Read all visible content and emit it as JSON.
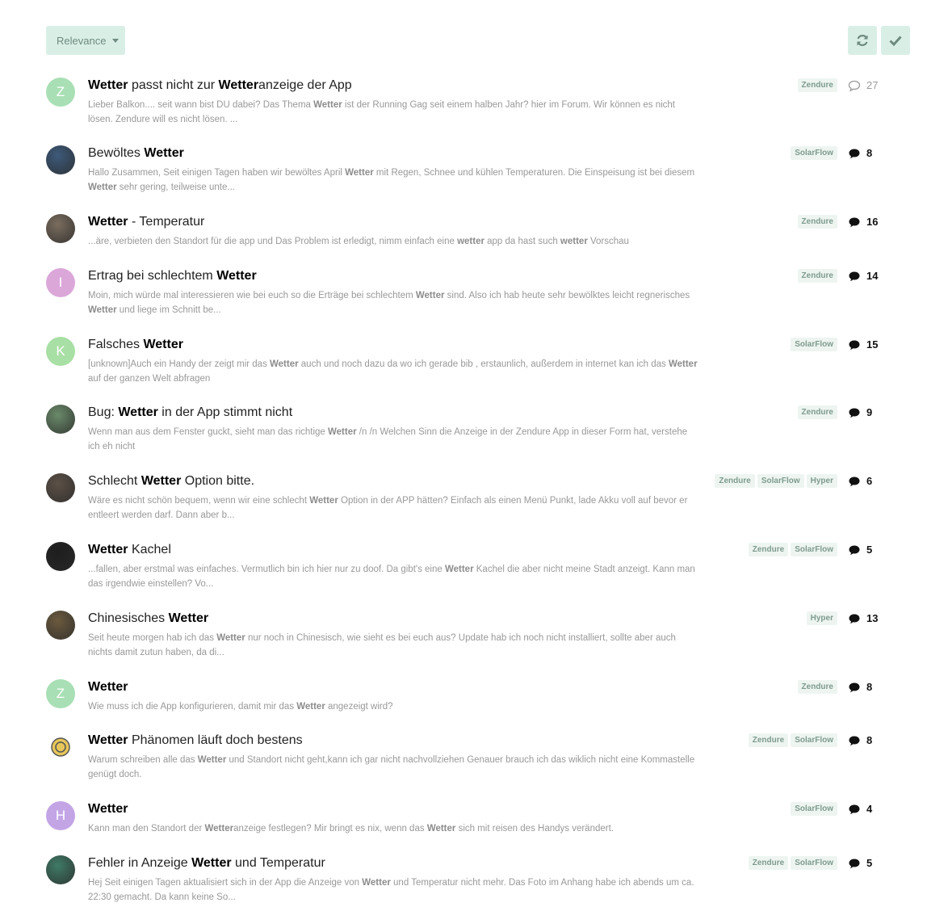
{
  "toolbar": {
    "sort_label": "Relevance"
  },
  "topics": [
    {
      "avatar_letter": "Z",
      "avatar_color": "#a8dfb4",
      "title": [
        {
          "b": true,
          "t": "Wetter"
        },
        {
          "b": false,
          "t": " passt nicht zur "
        },
        {
          "b": true,
          "t": "Wetter"
        },
        {
          "b": false,
          "t": "anzeige der App"
        }
      ],
      "snippet": [
        {
          "b": false,
          "t": "Lieber Balkon.... seit wann bist DU dabei? Das Thema "
        },
        {
          "b": true,
          "t": "Wetter"
        },
        {
          "b": false,
          "t": " ist der Running Gag seit einem halben Jahr? hier im Forum. Wir können es nicht lösen. Zendure will es nicht lösen. ..."
        }
      ],
      "tags": [
        "Zendure"
      ],
      "count": "27",
      "count_style": "outline"
    },
    {
      "avatar_letter": "",
      "avatar_color": "#3d5a7a",
      "title": [
        {
          "b": false,
          "t": "Bewöltes "
        },
        {
          "b": true,
          "t": "Wetter"
        }
      ],
      "snippet": [
        {
          "b": false,
          "t": "Hallo Zusammen, Seit einigen Tagen haben wir bewöltes April "
        },
        {
          "b": true,
          "t": "Wetter"
        },
        {
          "b": false,
          "t": " mit Regen, Schnee und kühlen Temperaturen. Die Einspeisung ist bei diesem "
        },
        {
          "b": true,
          "t": "Wetter"
        },
        {
          "b": false,
          "t": " sehr gering, teilweise unte..."
        }
      ],
      "tags": [
        "SolarFlow"
      ],
      "count": "8",
      "count_style": "solid"
    },
    {
      "avatar_letter": "",
      "avatar_color": "#7a6d5e",
      "title": [
        {
          "b": true,
          "t": "Wetter"
        },
        {
          "b": false,
          "t": " - Temperatur"
        }
      ],
      "snippet": [
        {
          "b": false,
          "t": "...äre, verbieten den Standort für die app und Das Problem ist erledigt, nimm einfach eine "
        },
        {
          "b": true,
          "t": "wetter"
        },
        {
          "b": false,
          "t": " app da hast such "
        },
        {
          "b": true,
          "t": "wetter"
        },
        {
          "b": false,
          "t": " Vorschau"
        }
      ],
      "tags": [
        "Zendure"
      ],
      "count": "16",
      "count_style": "solid"
    },
    {
      "avatar_letter": "I",
      "avatar_color": "#dba7d9",
      "title": [
        {
          "b": false,
          "t": "Ertrag bei schlechtem "
        },
        {
          "b": true,
          "t": "Wetter"
        }
      ],
      "snippet": [
        {
          "b": false,
          "t": "Moin, mich würde mal interessieren wie bei euch so die Erträge bei schlechtem "
        },
        {
          "b": true,
          "t": "Wetter"
        },
        {
          "b": false,
          "t": " sind. Also ich hab heute sehr bewölktes leicht regnerisches "
        },
        {
          "b": true,
          "t": "Wetter"
        },
        {
          "b": false,
          "t": " und liege im Schnitt be..."
        }
      ],
      "tags": [
        "Zendure"
      ],
      "count": "14",
      "count_style": "solid"
    },
    {
      "avatar_letter": "K",
      "avatar_color": "#a8dfa4",
      "title": [
        {
          "b": false,
          "t": "Falsches "
        },
        {
          "b": true,
          "t": "Wetter"
        }
      ],
      "snippet": [
        {
          "b": false,
          "t": "[unknown]Auch ein Handy der zeigt mir das "
        },
        {
          "b": true,
          "t": "Wetter"
        },
        {
          "b": false,
          "t": " auch und noch dazu da wo ich gerade bib , erstaunlich, außerdem in internet kan ich das "
        },
        {
          "b": true,
          "t": "Wetter"
        },
        {
          "b": false,
          "t": " auf der ganzen Welt abfragen"
        }
      ],
      "tags": [
        "SolarFlow"
      ],
      "count": "15",
      "count_style": "solid"
    },
    {
      "avatar_letter": "",
      "avatar_color": "#6a8a6a",
      "title": [
        {
          "b": false,
          "t": "Bug: "
        },
        {
          "b": true,
          "t": "Wetter"
        },
        {
          "b": false,
          "t": " in der App stimmt nicht"
        }
      ],
      "snippet": [
        {
          "b": false,
          "t": "Wenn man aus dem Fenster guckt, sieht man das richtige "
        },
        {
          "b": true,
          "t": "Wetter"
        },
        {
          "b": false,
          "t": " /n /n Welchen Sinn die Anzeige in der Zendure App in dieser Form hat, verstehe ich eh nicht"
        }
      ],
      "tags": [
        "Zendure"
      ],
      "count": "9",
      "count_style": "solid"
    },
    {
      "avatar_letter": "",
      "avatar_color": "#5c5046",
      "title": [
        {
          "b": false,
          "t": "Schlecht "
        },
        {
          "b": true,
          "t": "Wetter"
        },
        {
          "b": false,
          "t": " Option bitte."
        }
      ],
      "snippet": [
        {
          "b": false,
          "t": "Wäre es nicht schön bequem, wenn wir eine schlecht "
        },
        {
          "b": true,
          "t": "Wetter"
        },
        {
          "b": false,
          "t": " Option in der APP hätten? Einfach als einen Menü Punkt, lade Akku voll auf bevor er entleert werden darf. Dann aber b..."
        }
      ],
      "tags": [
        "Zendure",
        "SolarFlow",
        "Hyper"
      ],
      "count": "6",
      "count_style": "solid"
    },
    {
      "avatar_letter": "",
      "avatar_color": "#1e1e1e",
      "title": [
        {
          "b": true,
          "t": "Wetter"
        },
        {
          "b": false,
          "t": " Kachel"
        }
      ],
      "snippet": [
        {
          "b": false,
          "t": "...fallen, aber erstmal was einfaches. Vermutlich bin ich hier nur zu doof. Da gibt's eine "
        },
        {
          "b": true,
          "t": "Wetter"
        },
        {
          "b": false,
          "t": " Kachel die aber nicht meine Stadt anzeigt. Kann man das irgendwie einstellen? Vo..."
        }
      ],
      "tags": [
        "Zendure",
        "SolarFlow"
      ],
      "count": "5",
      "count_style": "solid"
    },
    {
      "avatar_letter": "",
      "avatar_color": "#6b5a3e",
      "title": [
        {
          "b": false,
          "t": "Chinesisches "
        },
        {
          "b": true,
          "t": "Wetter"
        }
      ],
      "snippet": [
        {
          "b": false,
          "t": "Seit heute morgen hab ich das "
        },
        {
          "b": true,
          "t": "Wetter"
        },
        {
          "b": false,
          "t": " nur noch in Chinesisch, wie sieht es bei euch aus? Update hab ich noch nicht installiert, sollte aber auch nichts damit zutun haben, da di..."
        }
      ],
      "tags": [
        "Hyper"
      ],
      "count": "13",
      "count_style": "solid"
    },
    {
      "avatar_letter": "Z",
      "avatar_color": "#a8dfb4",
      "title": [
        {
          "b": true,
          "t": "Wetter"
        }
      ],
      "snippet": [
        {
          "b": false,
          "t": "Wie muss ich die App konfigurieren, damit mir das "
        },
        {
          "b": true,
          "t": "Wetter"
        },
        {
          "b": false,
          "t": " angezeigt wird?"
        }
      ],
      "tags": [
        "Zendure"
      ],
      "count": "8",
      "count_style": "solid"
    },
    {
      "avatar_letter": "",
      "avatar_color": "#ffffff",
      "title": [
        {
          "b": true,
          "t": "Wetter"
        },
        {
          "b": false,
          "t": " Phänomen läuft doch bestens"
        }
      ],
      "snippet": [
        {
          "b": false,
          "t": "Warum schreiben alle das "
        },
        {
          "b": true,
          "t": "Wetter"
        },
        {
          "b": false,
          "t": " und Standort nicht geht,kann ich gar nicht nachvollziehen Genauer brauch ich das wiklich nicht eine Kommastelle genügt doch."
        }
      ],
      "tags": [
        "Zendure",
        "SolarFlow"
      ],
      "count": "8",
      "count_style": "solid"
    },
    {
      "avatar_letter": "H",
      "avatar_color": "#c3a5e6",
      "title": [
        {
          "b": true,
          "t": "Wetter"
        }
      ],
      "snippet": [
        {
          "b": false,
          "t": "Kann man den Standort der "
        },
        {
          "b": true,
          "t": "Wetter"
        },
        {
          "b": false,
          "t": "anzeige festlegen? Mir bringt es nix, wenn das "
        },
        {
          "b": true,
          "t": "Wetter"
        },
        {
          "b": false,
          "t": " sich mit reisen des Handys verändert."
        }
      ],
      "tags": [
        "SolarFlow"
      ],
      "count": "4",
      "count_style": "solid"
    },
    {
      "avatar_letter": "",
      "avatar_color": "#3f7a66",
      "title": [
        {
          "b": false,
          "t": "Fehler in Anzeige "
        },
        {
          "b": true,
          "t": "Wetter"
        },
        {
          "b": false,
          "t": " und Temperatur"
        }
      ],
      "snippet": [
        {
          "b": false,
          "t": "Hej Seit einigen Tagen aktualisiert sich in der App die Anzeige von "
        },
        {
          "b": true,
          "t": "Wetter"
        },
        {
          "b": false,
          "t": " und Temperatur nicht mehr. Das Foto im Anhang habe ich abends um ca. 22:30 gemacht. Da kann keine So..."
        }
      ],
      "tags": [
        "Zendure",
        "SolarFlow"
      ],
      "count": "5",
      "count_style": "solid"
    }
  ]
}
